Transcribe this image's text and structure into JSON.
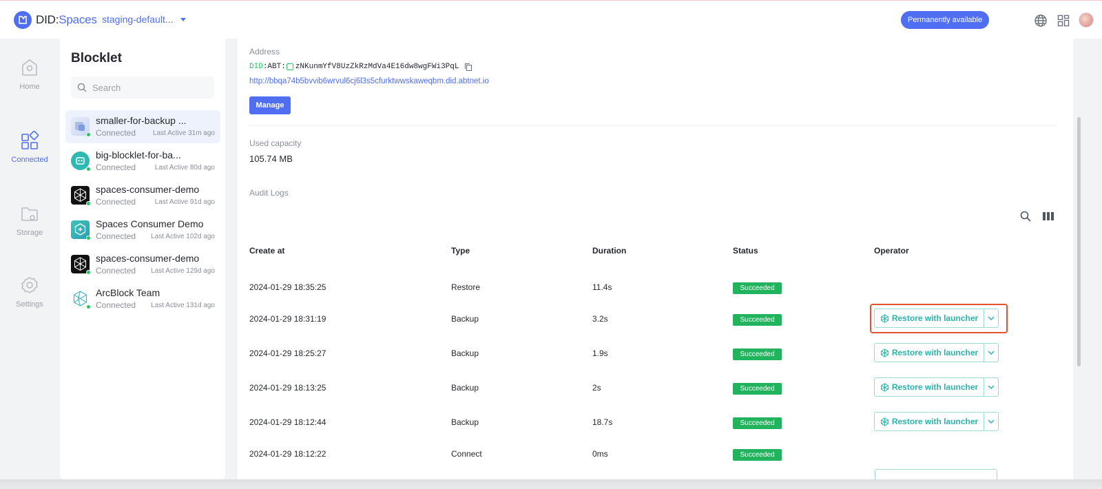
{
  "app": {
    "logo_did": "DID",
    "logo_sep": ":",
    "logo_spaces": "Spaces"
  },
  "header": {
    "space_name": "staging-default...",
    "badge": "Permanently available"
  },
  "rail": [
    {
      "label": "Home",
      "icon": "home-icon"
    },
    {
      "label": "Connected",
      "icon": "grid-icon"
    },
    {
      "label": "Storage",
      "icon": "folder-icon"
    },
    {
      "label": "Settings",
      "icon": "gear-icon"
    }
  ],
  "panel": {
    "title": "Blocklet",
    "search_placeholder": "Search",
    "items": [
      {
        "name": "smaller-for-backup ...",
        "status": "Connected",
        "last_active": "Last Active 31m ago"
      },
      {
        "name": "big-blocklet-for-ba...",
        "status": "Connected",
        "last_active": "Last Active 80d ago"
      },
      {
        "name": "spaces-consumer-demo",
        "status": "Connected",
        "last_active": "Last Active 91d ago"
      },
      {
        "name": "Spaces Consumer Demo",
        "status": "Connected",
        "last_active": "Last Active 102d ago"
      },
      {
        "name": "spaces-consumer-demo",
        "status": "Connected",
        "last_active": "Last Active 129d ago"
      },
      {
        "name": "ArcBlock Team",
        "status": "Connected",
        "last_active": "Last Active 131d ago"
      }
    ]
  },
  "main": {
    "address_label": "Address",
    "did_prefix": "DID",
    "did_type": ":ABT:",
    "did_value": "zNKunmYfV8UzZkRzMdVa4E16dw8wgFWi3PqL",
    "address_url": "http://bbqa74b5bvvib6wrvul6cj6l3s5cfurktwwskaweqbm.did.abtnet.io",
    "manage_label": "Manage",
    "capacity_label": "Used capacity",
    "capacity_value": "105.74 MB",
    "audit_label": "Audit Logs"
  },
  "table": {
    "headers": {
      "created": "Create at",
      "type": "Type",
      "duration": "Duration",
      "status": "Status",
      "operator": "Operator"
    },
    "restore_label": "Restore with launcher",
    "rows": [
      {
        "created": "2024-01-29 18:35:25",
        "type": "Restore",
        "duration": "11.4s",
        "status": "Succeeded"
      },
      {
        "created": "2024-01-29 18:31:19",
        "type": "Backup",
        "duration": "3.2s",
        "status": "Succeeded"
      },
      {
        "created": "2024-01-29 18:25:27",
        "type": "Backup",
        "duration": "1.9s",
        "status": "Succeeded"
      },
      {
        "created": "2024-01-29 18:13:25",
        "type": "Backup",
        "duration": "2s",
        "status": "Succeeded"
      },
      {
        "created": "2024-01-29 18:12:44",
        "type": "Backup",
        "duration": "18.7s",
        "status": "Succeeded"
      },
      {
        "created": "2024-01-29 18:12:22",
        "type": "Connect",
        "duration": "0ms",
        "status": "Succeeded"
      }
    ]
  },
  "colors": {
    "accent": "#4f6ef2",
    "success": "#22b35e",
    "teal": "#2bb3ad",
    "highlight": "#e5532f"
  }
}
